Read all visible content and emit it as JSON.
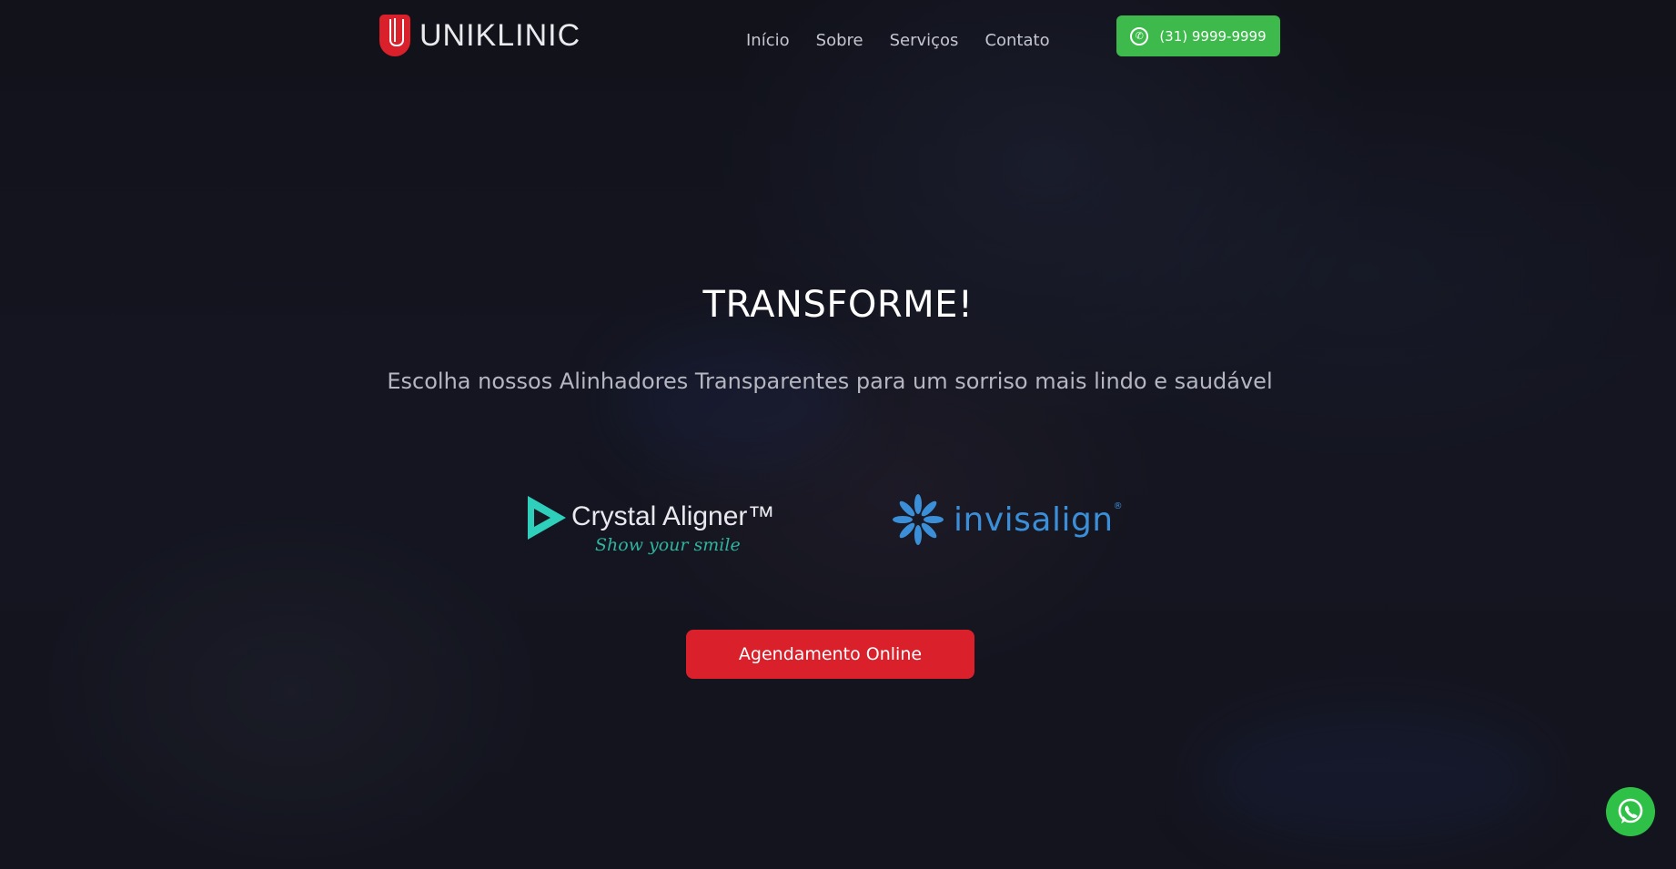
{
  "header": {
    "logo_text": "UNIKLINIC",
    "nav": [
      {
        "label": "Início"
      },
      {
        "label": "Sobre"
      },
      {
        "label": "Serviços"
      },
      {
        "label": "Contato"
      }
    ],
    "phone_button": {
      "label": "(31) 9999-9999",
      "icon": "whatsapp-icon"
    }
  },
  "hero": {
    "title": "TRANSFORME!",
    "subtitle": "Escolha nossos Alinhadores Transparentes para um sorriso mais lindo e saudável",
    "brands": {
      "crystal": {
        "name": "Crystal Aligner™",
        "tagline": "Show your smile"
      },
      "invisalign": {
        "name": "invisalign",
        "reg": "®"
      }
    },
    "cta_label": "Agendamento Online"
  },
  "floating_whatsapp": {
    "icon": "whatsapp-icon"
  },
  "colors": {
    "brand_red": "#d9202b",
    "whatsapp_green": "#3dba4b",
    "crystal_teal": "#2fd0bb",
    "invisalign_blue": "#3a8fd8",
    "background": "#171821"
  }
}
